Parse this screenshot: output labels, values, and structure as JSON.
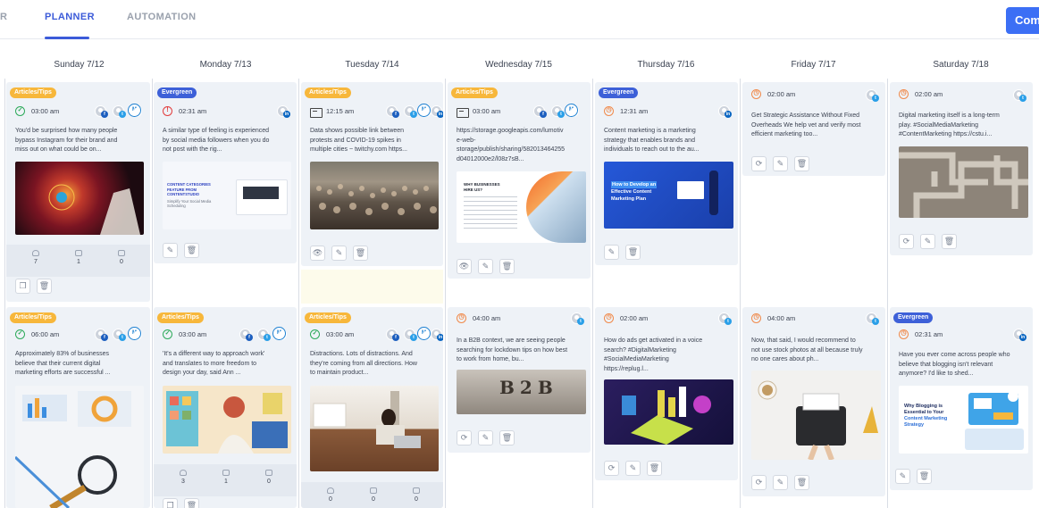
{
  "nav": {
    "tabs": [
      {
        "label": "R"
      },
      {
        "label": "PLANNER"
      },
      {
        "label": "AUTOMATION"
      }
    ],
    "cta_label": "Comp"
  },
  "days": [
    {
      "label": "Sunday 7/12"
    },
    {
      "label": "Monday 7/13"
    },
    {
      "label": "Tuesday 7/14"
    },
    {
      "label": "Wednesday 7/15"
    },
    {
      "label": "Thursday 7/16"
    },
    {
      "label": "Friday 7/17"
    },
    {
      "label": "Saturday 7/18"
    }
  ],
  "colors": {
    "accent": "#3c5bd9",
    "tips_pill": "#f7b73b",
    "evergreen_pill": "#3d60d8",
    "published": "#2daa5a",
    "failed": "#e23b3b",
    "scheduled": "#f08a4b"
  },
  "posts": [
    {
      "category": "Articles/Tips",
      "status_icon": "check-circle-icon",
      "time": "03:00 am",
      "text": [
        "You'd be surprised how many people",
        "bypass Instagram for their brand and",
        "miss out on what could be on..."
      ],
      "stats": {
        "likes": "7",
        "shares": "1",
        "comments": "0"
      }
    },
    {
      "category": "Evergreen",
      "status_icon": "alert-circle-icon",
      "time": "02:31 am",
      "text": [
        "A similar type of feeling is experienced",
        "by social media followers when you do",
        "not post with the rig..."
      ],
      "image_text": [
        "CONTENT CATEGORIES",
        "FEATURE FROM",
        "CONTENTSTUDIO",
        "Simplify Your Social Media",
        "Scheduling"
      ]
    },
    {
      "category": "Articles/Tips",
      "status_icon": "folder-icon",
      "time": "12:15 am",
      "text": [
        "Data shows possible link between",
        "protests and COVID-19 spikes in",
        "multiple cities ~ twitchy.com https..."
      ]
    },
    {
      "category": "Articles/Tips",
      "status_icon": "folder-icon",
      "time": "03:00 am",
      "text": [
        "https://storage.googleapis.com/lumotiv",
        "e-web-",
        "storage/publish/sharing/582013464255",
        "d04012000e2/l08z7sB..."
      ],
      "image_text": [
        "WHY BUSINESSES",
        "HIRE US?"
      ]
    },
    {
      "category": "Evergreen",
      "status_icon": "clock-icon",
      "time": "12:31 am",
      "text": [
        "Content marketing is a marketing",
        "strategy that enables brands and",
        "individuals to reach out to the au..."
      ],
      "image_text": [
        "How to Develop an",
        "Effective Content",
        "Marketing Plan"
      ]
    },
    {
      "category": "",
      "status_icon": "clock-icon",
      "time": "02:00 am",
      "text": [
        "Get Strategic Assistance Without Fixed",
        "Overheads We help vet and verify most",
        "efficient marketing too..."
      ]
    },
    {
      "category": "",
      "status_icon": "clock-icon",
      "time": "02:00 am",
      "text": [
        "Digital marketing itself is a long-term",
        "play. #SocialMediaMarketing",
        "#ContentMarketing https://cstu.i..."
      ]
    },
    {
      "category": "Articles/Tips",
      "status_icon": "check-circle-icon",
      "time": "06:00 am",
      "text": [
        "Approximately 83% of businesses",
        "believe that their current digital",
        "marketing efforts are successful ..."
      ]
    },
    {
      "category": "Articles/Tips",
      "status_icon": "check-circle-icon",
      "time": "03:00 am",
      "text": [
        "'It's a different way to approach work'",
        "and translates to more freedom to",
        "design your day, said Ann ..."
      ],
      "stats": {
        "likes": "3",
        "shares": "1",
        "comments": "0"
      }
    },
    {
      "category": "Articles/Tips",
      "status_icon": "check-circle-icon",
      "time": "03:00 am",
      "text": [
        "Distractions. Lots of distractions. And",
        "they're coming from all directions. How",
        "to maintain product..."
      ],
      "stats": {
        "likes": "0",
        "shares": "0",
        "comments": "0"
      }
    },
    {
      "category": "",
      "status_icon": "clock-icon",
      "time": "04:00 am",
      "text": [
        "In a B2B context, we are seeing people",
        "searching for lockdown tips on how best",
        "to work from home, bu..."
      ],
      "image_text": [
        "B2B"
      ]
    },
    {
      "category": "",
      "status_icon": "clock-icon",
      "time": "02:00 am",
      "text": [
        "How do ads get activated in a voice",
        "search? #DigitalMarketing",
        "#SocialMediaMarketing",
        "https://replug.l..."
      ]
    },
    {
      "category": "",
      "status_icon": "clock-icon",
      "time": "04:00 am",
      "text": [
        "Now, that said, I would recommend to",
        "not use stock photos at all because truly",
        "no one cares about ph..."
      ]
    },
    {
      "category": "Evergreen",
      "status_icon": "clock-icon",
      "time": "02:31 am",
      "text": [
        "Have you ever come across people who",
        "believe that blogging isn't relevant",
        "anymore? I'd like to shed..."
      ],
      "image_text": [
        "Why Blogging is",
        "Essential to Your",
        "Content Marketing",
        "Strategy"
      ]
    }
  ]
}
